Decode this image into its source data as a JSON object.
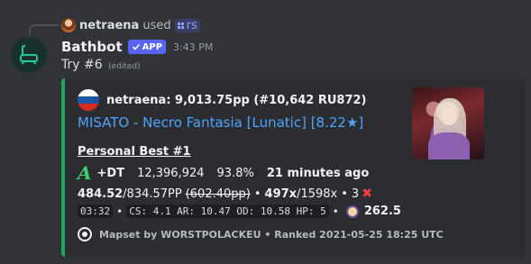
{
  "reply": {
    "username": "netraena",
    "action": "used",
    "command": "rs",
    "icon": "slash-command-icon"
  },
  "message": {
    "bot_name": "Bathbot",
    "badge": "APP",
    "timestamp": "3:43 PM",
    "content": "Try #6",
    "edited": "(edited)"
  },
  "embed": {
    "accent_color": "#23a55a",
    "author": "netraena: 9,013.75pp (#10,642 RU872)",
    "title": "MISATO - Necro Fantasia [Lunatic] [8.22★]",
    "personal_best": "Personal Best #1",
    "grade": "A",
    "mods": "+DT",
    "score": "12,396,924",
    "accuracy": "93.8%",
    "time_ago": "21 minutes ago",
    "pp": "484.52",
    "pp_max": "/834.57PP",
    "pp_fc": "(602.40pp)",
    "combo": "497x",
    "combo_max": "/1598x",
    "sep": "•",
    "misses": "3",
    "miss_symbol": "✖",
    "map_attrs": {
      "length": "03:32",
      "stats": "CS: 4.1 AR: 10.47 OD: 10.58 HP: 5",
      "star_rating": "262.5"
    },
    "footer": "Mapset by WORSTPOLACKEU • Ranked 2021-05-25 18:25 UTC"
  }
}
